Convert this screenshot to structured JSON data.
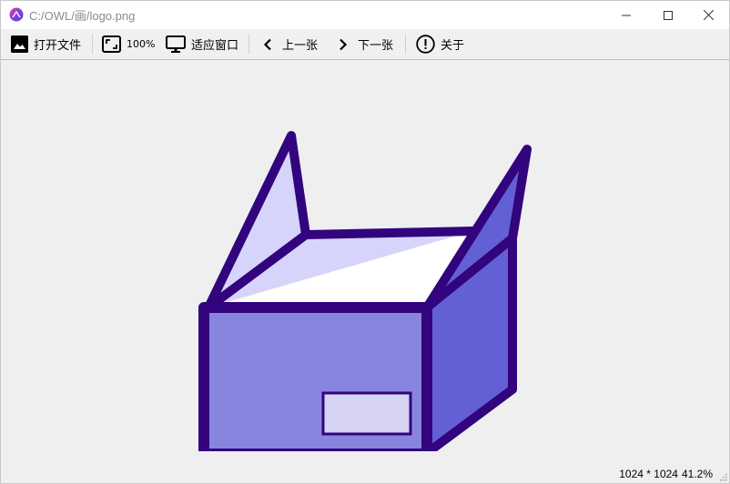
{
  "window": {
    "title": "C:/OWL/画/logo.png"
  },
  "toolbar": {
    "open_label": "打开文件",
    "actual_size_label": "100%",
    "fit_window_label": "适应窗口",
    "prev_label": "上一张",
    "next_label": "下一张",
    "about_label": "关于"
  },
  "status": {
    "dimensions": "1024 * 1024",
    "zoom": "41.2%"
  },
  "icons": {
    "open": "image-icon",
    "actual_size": "actual-size-icon",
    "fit_window": "monitor-icon",
    "prev": "chevron-left-icon",
    "next": "chevron-right-icon",
    "about": "info-icon"
  },
  "colors": {
    "box_outline": "#32047d",
    "box_front": "#8885de",
    "box_side": "#635fd5",
    "flap_light": "#d6d4fb",
    "label_fill": "#d6d4f2"
  }
}
